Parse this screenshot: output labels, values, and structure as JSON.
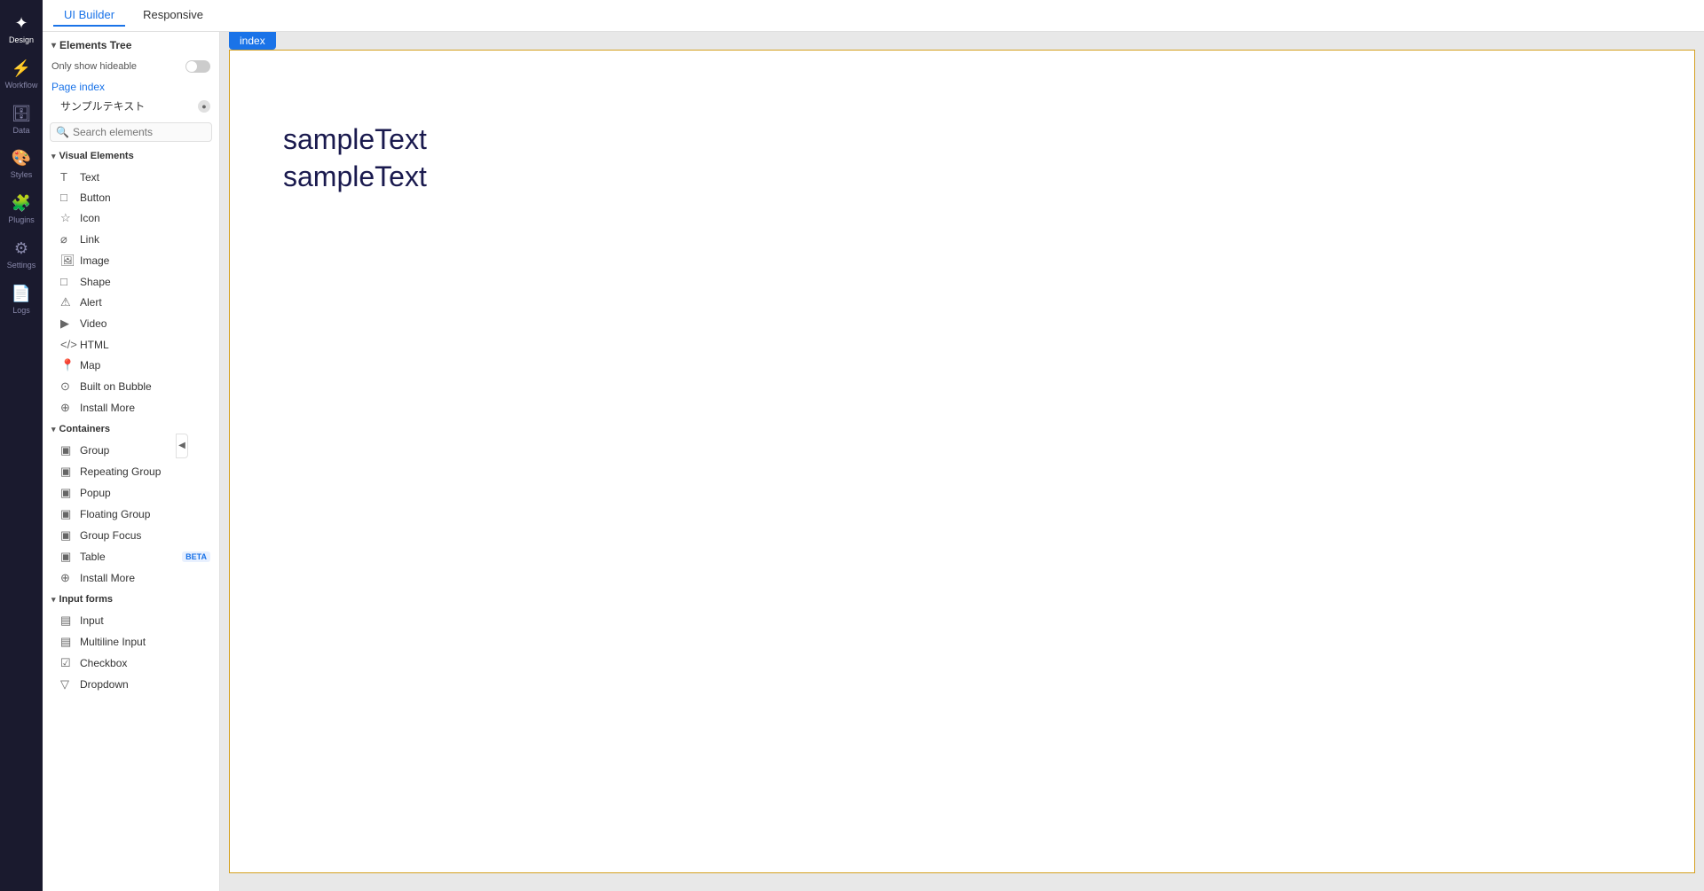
{
  "nav": {
    "items": [
      {
        "id": "design",
        "icon": "✦",
        "label": "Design",
        "active": true
      },
      {
        "id": "workflow",
        "icon": "⚡",
        "label": "Workflow",
        "active": false
      },
      {
        "id": "data",
        "icon": "🗄",
        "label": "Data",
        "active": false
      },
      {
        "id": "styles",
        "icon": "🎨",
        "label": "Styles",
        "active": false
      },
      {
        "id": "plugins",
        "icon": "🧩",
        "label": "Plugins",
        "active": false
      },
      {
        "id": "settings",
        "icon": "⚙",
        "label": "Settings",
        "active": false
      },
      {
        "id": "logs",
        "icon": "📄",
        "label": "Logs",
        "active": false
      }
    ]
  },
  "topbar": {
    "tabs": [
      {
        "id": "ui-builder",
        "label": "UI Builder",
        "active": true
      },
      {
        "id": "responsive",
        "label": "Responsive",
        "active": false
      }
    ]
  },
  "leftpanel": {
    "elements_tree_label": "Elements Tree",
    "only_show_hideable": "Only show hideable",
    "page_index_label": "Page index",
    "sample_text_label": "サンプルテキスト",
    "search_placeholder": "Search elements",
    "visual_elements_label": "Visual Elements",
    "items_visual": [
      {
        "id": "text",
        "icon": "T",
        "label": "Text"
      },
      {
        "id": "button",
        "icon": "□",
        "label": "Button"
      },
      {
        "id": "icon",
        "icon": "☆",
        "label": "Icon"
      },
      {
        "id": "link",
        "icon": "⌀",
        "label": "Link"
      },
      {
        "id": "image",
        "icon": "🖼",
        "label": "Image"
      },
      {
        "id": "shape",
        "icon": "□",
        "label": "Shape"
      },
      {
        "id": "alert",
        "icon": "⚠",
        "label": "Alert"
      },
      {
        "id": "video",
        "icon": "▶",
        "label": "Video"
      },
      {
        "id": "html",
        "icon": "⌀",
        "label": "HTML"
      },
      {
        "id": "map",
        "icon": "📍",
        "label": "Map"
      },
      {
        "id": "built-on-bubble",
        "icon": "⊙",
        "label": "Built on Bubble"
      },
      {
        "id": "install-more-visual",
        "icon": "⊕",
        "label": "Install More"
      }
    ],
    "containers_label": "Containers",
    "items_containers": [
      {
        "id": "group",
        "icon": "▣",
        "label": "Group",
        "beta": false
      },
      {
        "id": "repeating-group",
        "icon": "▣",
        "label": "Repeating Group",
        "beta": false
      },
      {
        "id": "popup",
        "icon": "▣",
        "label": "Popup",
        "beta": false
      },
      {
        "id": "floating-group",
        "icon": "▣",
        "label": "Floating Group",
        "beta": false
      },
      {
        "id": "group-focus",
        "icon": "▣",
        "label": "Group Focus",
        "beta": false
      },
      {
        "id": "table",
        "icon": "▣",
        "label": "Table",
        "beta": true
      },
      {
        "id": "install-more-containers",
        "icon": "⊕",
        "label": "Install More",
        "beta": false
      }
    ],
    "input_forms_label": "Input forms",
    "items_input": [
      {
        "id": "input",
        "icon": "▤",
        "label": "Input"
      },
      {
        "id": "multiline-input",
        "icon": "▤",
        "label": "Multiline Input"
      },
      {
        "id": "checkbox",
        "icon": "☑",
        "label": "Checkbox"
      },
      {
        "id": "dropdown",
        "icon": "▽",
        "label": "Dropdown"
      }
    ]
  },
  "canvas": {
    "tab_label": "index",
    "sample_text_1": "sampleText",
    "sample_text_2": "sampleText"
  }
}
